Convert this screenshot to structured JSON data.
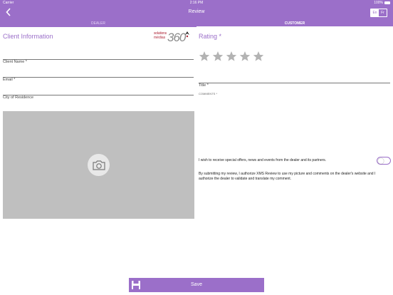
{
  "status_bar": {
    "carrier": "Carrier",
    "time": "2:16 PM",
    "battery": "100%"
  },
  "nav": {
    "back_icon": "chevron-left-icon",
    "title": "Review",
    "languages": [
      "En",
      "Fr"
    ],
    "selected_language": "En"
  },
  "tabs": [
    {
      "label": "DEALER",
      "active": false
    },
    {
      "label": "CUSTOMER",
      "active": true
    }
  ],
  "client_info": {
    "heading": "Client Information",
    "logo": {
      "line1": "solutions",
      "line2": "médias",
      "number": "360"
    },
    "fields": {
      "client_name": "Client Name *",
      "email": "Email *",
      "city": "City of Residence"
    },
    "photo_icon": "camera-icon"
  },
  "rating": {
    "heading": "Rating *",
    "max_stars": 5,
    "value": 0,
    "title_placeholder": "Title *",
    "comments_placeholder": "COMMENTS *",
    "optin_text": "I wish to receive special offers, news and events from the dealer and its partners.",
    "optin_enabled": false,
    "legal_text": "By submitting my review, I authorize XMS Review to use my picture and comments on the dealer's website and I authorize the dealer to validate and translate my comment."
  },
  "save": {
    "label": "Save",
    "icon": "save-disk-icon"
  },
  "colors": {
    "accent": "#9b6fc9",
    "photo_bg": "#bfbfbf",
    "star": "#b3b3b3"
  }
}
